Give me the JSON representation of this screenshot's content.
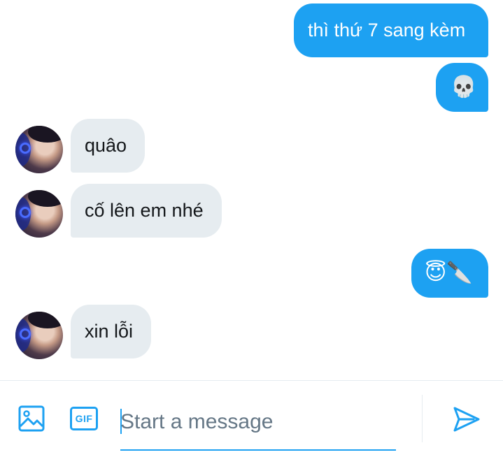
{
  "messages": [
    {
      "direction": "out",
      "text": "thì thứ 7 sang kèm"
    },
    {
      "direction": "out",
      "text": "💀"
    },
    {
      "direction": "in",
      "text": "quâo"
    },
    {
      "direction": "in",
      "text": "cố lên em nhé"
    },
    {
      "direction": "out",
      "text": "😇🔪"
    },
    {
      "direction": "in",
      "text": "xin lỗi"
    }
  ],
  "composer": {
    "placeholder": "Start a message",
    "media_icon": "image-icon",
    "gif_label": "GIF",
    "send_icon": "send-icon"
  },
  "colors": {
    "accent": "#1da1f2",
    "incoming_bubble": "#e6ecf0",
    "incoming_text": "#14171a",
    "placeholder": "#657786"
  }
}
